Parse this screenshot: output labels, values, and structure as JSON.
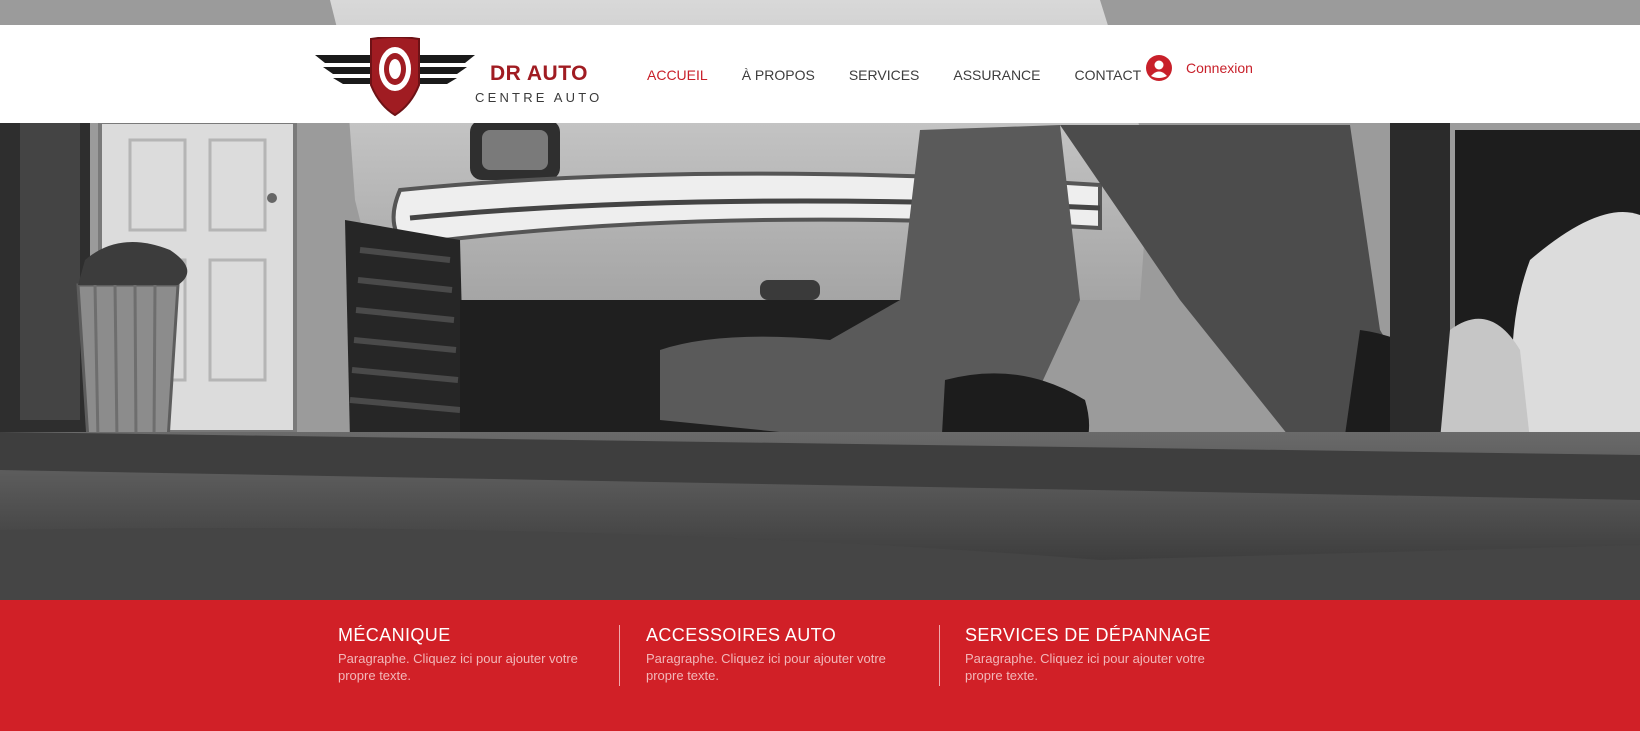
{
  "brand": {
    "name": "DR AUTO",
    "tagline": "CENTRE AUTO",
    "accent_color": "#c8202a",
    "dark_red": "#a01c22",
    "logo_icon": "winged-tire-shield-icon"
  },
  "nav": {
    "items": [
      {
        "label": "ACCUEIL",
        "active": true
      },
      {
        "label": "À PROPOS",
        "active": false
      },
      {
        "label": "SERVICES",
        "active": false
      },
      {
        "label": "ASSURANCE",
        "active": false
      },
      {
        "label": "CONTACT",
        "active": false
      }
    ]
  },
  "login": {
    "label": "Connexion",
    "icon": "user-avatar-icon"
  },
  "hero": {
    "image": "mechanic-under-car-photo"
  },
  "services": {
    "background_color": "#d12027",
    "items": [
      {
        "title": "MÉCANIQUE",
        "text": "Paragraphe. Cliquez ici pour ajouter votre propre texte."
      },
      {
        "title": "ACCESSOIRES AUTO",
        "text": "Paragraphe. Cliquez ici pour ajouter votre propre texte."
      },
      {
        "title": "SERVICES DE DÉPANNAGE",
        "text": "Paragraphe. Cliquez ici pour ajouter votre propre texte."
      }
    ]
  }
}
